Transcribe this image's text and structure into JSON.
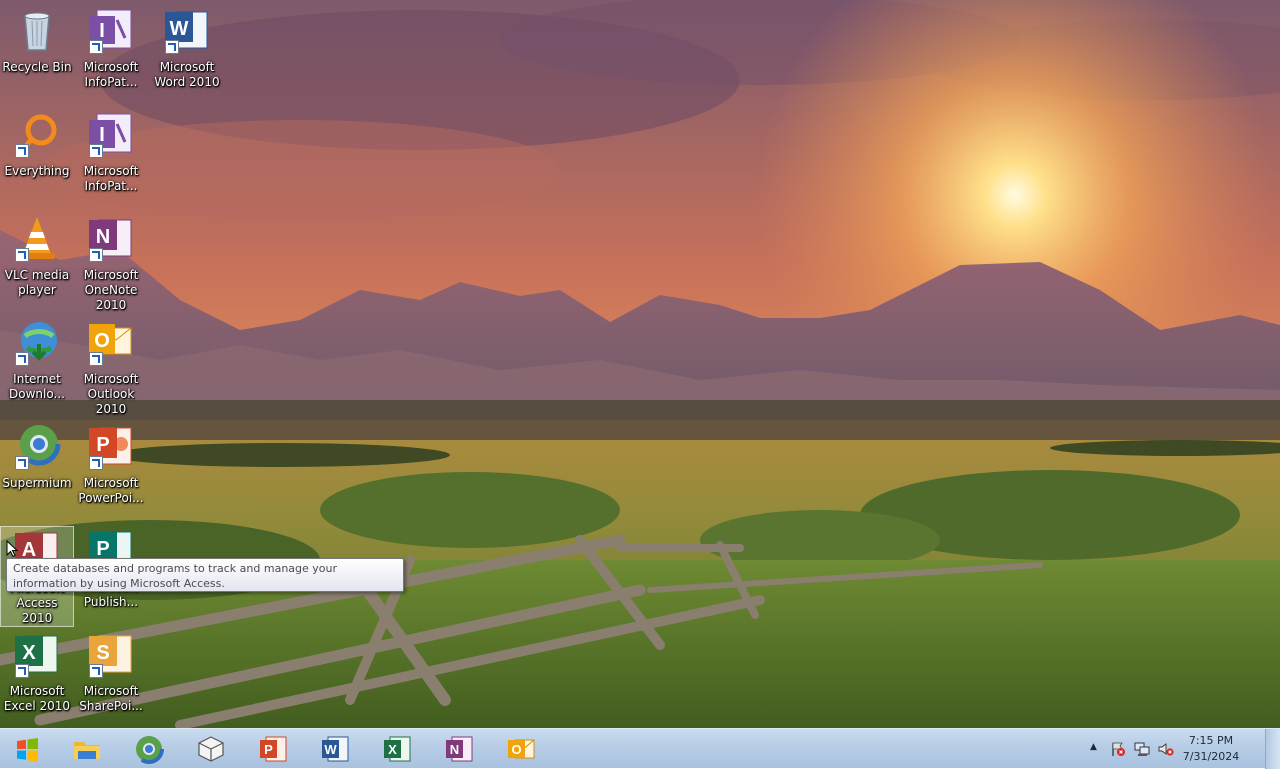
{
  "desktop": {
    "icons": [
      {
        "id": "recycle-bin",
        "label": "Recycle Bin",
        "icon": "recycle-bin-icon"
      },
      {
        "id": "infopath-1",
        "label": "Microsoft InfoPat...",
        "icon": "infopath-icon"
      },
      {
        "id": "word",
        "label": "Microsoft Word 2010",
        "icon": "word-icon"
      },
      {
        "id": "everything",
        "label": "Everything",
        "icon": "everything-search-icon"
      },
      {
        "id": "infopath-2",
        "label": "Microsoft InfoPat...",
        "icon": "infopath-icon"
      },
      {
        "id": "vlc",
        "label": "VLC media player",
        "icon": "vlc-cone-icon"
      },
      {
        "id": "onenote",
        "label": "Microsoft OneNote 2010",
        "icon": "onenote-icon"
      },
      {
        "id": "idm",
        "label": "Internet Downlo...",
        "icon": "internet-download-manager-icon"
      },
      {
        "id": "outlook",
        "label": "Microsoft Outlook 2010",
        "icon": "outlook-icon"
      },
      {
        "id": "supermium",
        "label": "Supermium",
        "icon": "supermium-browser-icon"
      },
      {
        "id": "powerpoint",
        "label": "Microsoft PowerPoi...",
        "icon": "powerpoint-icon"
      },
      {
        "id": "access",
        "label": "Microsoft Access 2010",
        "icon": "access-icon"
      },
      {
        "id": "publisher",
        "label": "Microsoft Publish...",
        "icon": "publisher-icon"
      },
      {
        "id": "excel",
        "label": "Microsoft Excel 2010",
        "icon": "excel-icon"
      },
      {
        "id": "sharepoint",
        "label": "Microsoft SharePoi...",
        "icon": "sharepoint-icon"
      }
    ]
  },
  "tooltip": {
    "text": "Create databases and programs to track and manage your information by using Microsoft Access."
  },
  "taskbar": {
    "start_icon": "windows-start-icon",
    "pinned": [
      {
        "id": "explorer",
        "icon": "file-explorer-icon"
      },
      {
        "id": "supermium",
        "icon": "supermium-browser-icon"
      },
      {
        "id": "box",
        "icon": "package-box-icon"
      },
      {
        "id": "powerpoint",
        "icon": "powerpoint-icon"
      },
      {
        "id": "word",
        "icon": "word-icon"
      },
      {
        "id": "excel",
        "icon": "excel-icon"
      },
      {
        "id": "onenote",
        "icon": "onenote-icon"
      },
      {
        "id": "outlook",
        "icon": "outlook-icon"
      }
    ],
    "tray": {
      "overflow_arrow": "▲",
      "icons": [
        "action-center-flag-icon",
        "network-icon",
        "volume-muted-icon"
      ]
    },
    "clock": {
      "time": "7:15 PM",
      "date": "7/31/2024"
    }
  },
  "colors": {
    "word": "#2b5797",
    "excel": "#1e7145",
    "powerpoint": "#d24726",
    "outlook": "#f0a30a",
    "onenote": "#80397b",
    "infopath": "#7b4fa6",
    "access": "#a4373a",
    "publisher": "#077568",
    "sharepoint": "#e9a53b"
  }
}
